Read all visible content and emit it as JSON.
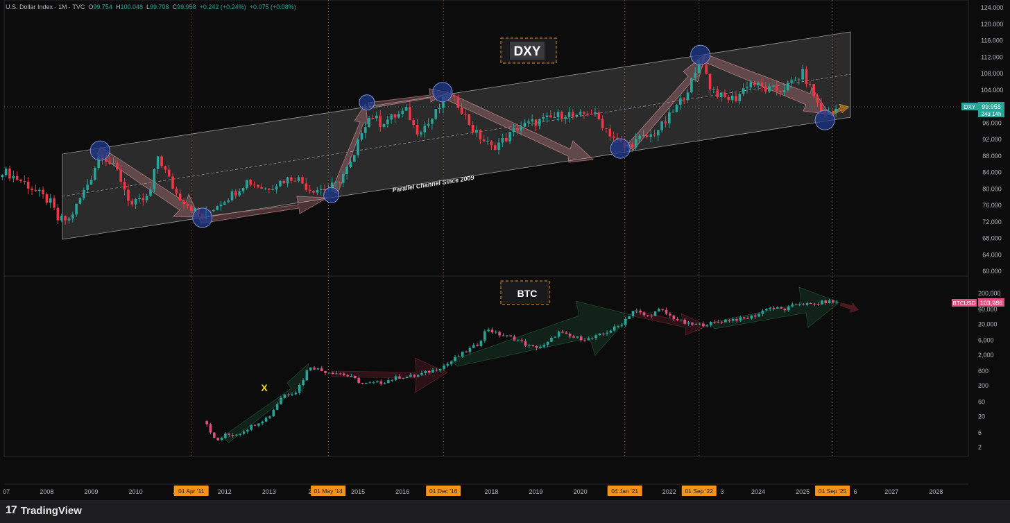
{
  "header": {
    "symbol": "U.S. Dollar Index · 1M · TVC",
    "o_label": "O",
    "o": "99.754",
    "h_label": "H",
    "h": "100.048",
    "l_label": "L",
    "l": "99.708",
    "c_label": "C",
    "c": "99.958",
    "change": "+0.242 (+0.24%)",
    "change2": "+0.075 (+0.08%)"
  },
  "footer": {
    "brand": "TradingView",
    "logo": "17"
  },
  "colors": {
    "up": "#26a69a",
    "down": "#f23645",
    "circle": "#1f3a8f",
    "date_tag": "#f7931a",
    "channel": "#ffffff"
  },
  "chart_data": [
    {
      "type": "candlestick",
      "pane": "DXY",
      "box_label": "DXY",
      "channel_label": "Parallel Channel Since 2009",
      "price_tag": {
        "label": "DXY",
        "value": "99.958",
        "sub": "24d 14h"
      },
      "y_ticks": [
        "124.000",
        "120.000",
        "116.000",
        "112.000",
        "108.000",
        "104.000",
        "100.000",
        "96.000",
        "92.000",
        "88.000",
        "84.000",
        "80.000",
        "76.000",
        "72.000",
        "68.000",
        "64.000",
        "60.000"
      ],
      "ylim": [
        58,
        125
      ],
      "last_close": 99.958,
      "path": [
        [
          2007.0,
          84.5
        ],
        [
          2007.5,
          81.5
        ],
        [
          2008.1,
          76.5
        ],
        [
          2008.25,
          72.5
        ],
        [
          2008.5,
          72.5
        ],
        [
          2008.7,
          76.5
        ],
        [
          2009.0,
          83
        ],
        [
          2009.2,
          89
        ],
        [
          2009.6,
          84
        ],
        [
          2009.9,
          76
        ],
        [
          2010.3,
          78
        ],
        [
          2010.5,
          88
        ],
        [
          2010.9,
          79
        ],
        [
          2011.3,
          75
        ],
        [
          2011.5,
          73
        ],
        [
          2011.8,
          76
        ],
        [
          2012.2,
          79
        ],
        [
          2012.5,
          82
        ],
        [
          2012.9,
          80
        ],
        [
          2013.3,
          82
        ],
        [
          2013.6,
          83
        ],
        [
          2013.9,
          80
        ],
        [
          2014.3,
          80
        ],
        [
          2014.5,
          81
        ],
        [
          2014.9,
          87
        ],
        [
          2015.1,
          95
        ],
        [
          2015.3,
          98
        ],
        [
          2015.5,
          96
        ],
        [
          2015.9,
          98
        ],
        [
          2016.1,
          99
        ],
        [
          2016.3,
          94
        ],
        [
          2016.6,
          96
        ],
        [
          2016.9,
          101
        ],
        [
          2017.0,
          103
        ],
        [
          2017.3,
          100
        ],
        [
          2017.6,
          94
        ],
        [
          2018.0,
          90
        ],
        [
          2018.3,
          92
        ],
        [
          2018.6,
          95
        ],
        [
          2018.9,
          96
        ],
        [
          2019.3,
          97
        ],
        [
          2019.7,
          98.5
        ],
        [
          2019.9,
          97
        ],
        [
          2020.2,
          99
        ],
        [
          2020.4,
          97
        ],
        [
          2020.7,
          93
        ],
        [
          2021.0,
          90
        ],
        [
          2021.3,
          92
        ],
        [
          2021.6,
          93
        ],
        [
          2021.9,
          96
        ],
        [
          2022.3,
          102
        ],
        [
          2022.6,
          108
        ],
        [
          2022.7,
          113
        ],
        [
          2022.9,
          105
        ],
        [
          2023.2,
          102
        ],
        [
          2023.5,
          102
        ],
        [
          2023.8,
          106
        ],
        [
          2024.2,
          104
        ],
        [
          2024.5,
          104
        ],
        [
          2024.8,
          106
        ],
        [
          2025.0,
          108
        ],
        [
          2025.2,
          104
        ],
        [
          2025.4,
          99
        ],
        [
          2025.6,
          98
        ],
        [
          2025.8,
          99.958
        ]
      ],
      "annotations": {
        "circles": [
          [
            2009.2,
            89.3
          ],
          [
            2011.5,
            73
          ],
          [
            2014.4,
            78.5
          ],
          [
            2015.2,
            101
          ],
          [
            2016.9,
            103.5
          ],
          [
            2020.9,
            89.8
          ],
          [
            2022.7,
            112.5
          ],
          [
            2025.5,
            96.7
          ]
        ]
      }
    },
    {
      "type": "candlestick",
      "pane": "BTC",
      "box_label": "BTC",
      "mark_label": "X",
      "price_tag": {
        "label": "BTCUSD",
        "value": "103,986"
      },
      "y_ticks": [
        "200,000",
        "60,000",
        "20,000",
        "6,000",
        "2,000",
        "600",
        "200",
        "60",
        "20",
        "6",
        "2"
      ],
      "scale": "log",
      "last_close": 103986,
      "path": [
        [
          2011.6,
          12
        ],
        [
          2011.8,
          3
        ],
        [
          2012.0,
          5
        ],
        [
          2012.3,
          5.5
        ],
        [
          2012.7,
          12
        ],
        [
          2013.0,
          20
        ],
        [
          2013.3,
          100
        ],
        [
          2013.6,
          130
        ],
        [
          2013.8,
          400
        ],
        [
          2013.9,
          900
        ],
        [
          2014.2,
          600
        ],
        [
          2014.6,
          500
        ],
        [
          2014.9,
          350
        ],
        [
          2015.1,
          230
        ],
        [
          2015.5,
          250
        ],
        [
          2015.9,
          380
        ],
        [
          2016.3,
          420
        ],
        [
          2016.7,
          650
        ],
        [
          2017.0,
          1000
        ],
        [
          2017.4,
          2500
        ],
        [
          2017.7,
          4500
        ],
        [
          2017.9,
          15000
        ],
        [
          2018.1,
          10000
        ],
        [
          2018.5,
          7000
        ],
        [
          2018.9,
          3500
        ],
        [
          2019.2,
          4000
        ],
        [
          2019.5,
          11000
        ],
        [
          2019.8,
          7500
        ],
        [
          2020.2,
          6500
        ],
        [
          2020.5,
          9500
        ],
        [
          2020.9,
          19000
        ],
        [
          2021.2,
          58000
        ],
        [
          2021.5,
          35000
        ],
        [
          2021.8,
          60000
        ],
        [
          2022.0,
          38000
        ],
        [
          2022.4,
          20000
        ],
        [
          2022.7,
          19000
        ],
        [
          2023.0,
          22000
        ],
        [
          2023.3,
          28000
        ],
        [
          2023.7,
          30000
        ],
        [
          2024.0,
          42000
        ],
        [
          2024.2,
          70000
        ],
        [
          2024.6,
          60000
        ],
        [
          2024.9,
          95000
        ],
        [
          2025.2,
          85000
        ],
        [
          2025.5,
          108000
        ],
        [
          2025.8,
          103986
        ]
      ]
    }
  ],
  "x_axis": {
    "years": [
      "07",
      "2008",
      "2009",
      "2010",
      "2",
      "2012",
      "2013",
      "2",
      "2015",
      "2016",
      "2018",
      "2019",
      "2020",
      "2022",
      "3",
      "2024",
      "2025",
      "6",
      "2027",
      "2028"
    ],
    "date_tags": [
      "01 Apr '11",
      "01 May '14",
      "01 Dec '16",
      "04 Jan '21",
      "01 Sep '22",
      "01 Sep '25"
    ]
  }
}
